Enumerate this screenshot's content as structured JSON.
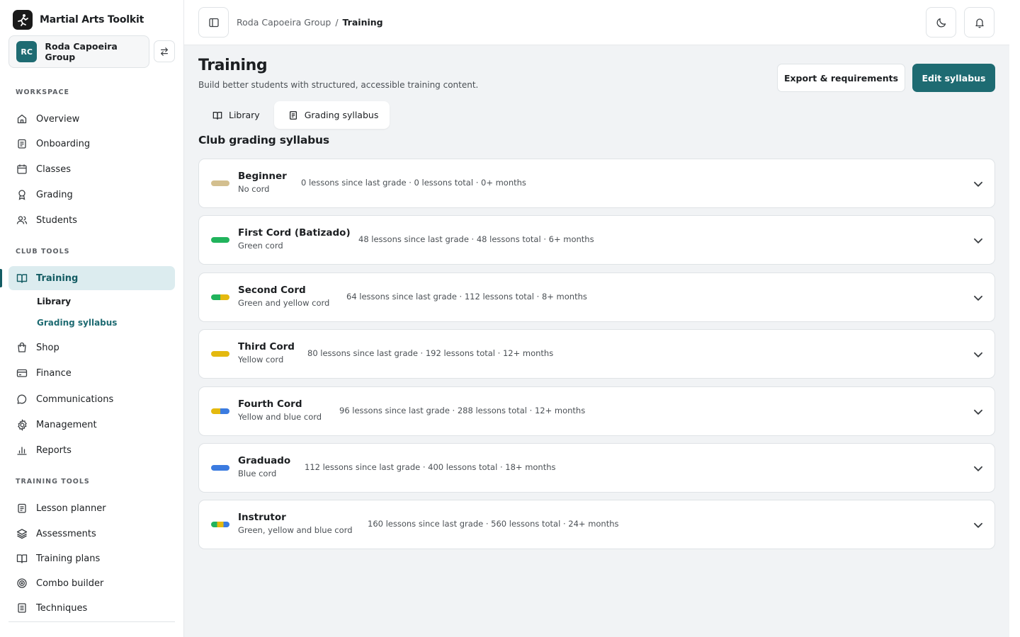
{
  "app": {
    "name": "Martial Arts Toolkit"
  },
  "org": {
    "initials": "RC",
    "name": "Roda Capoeira Group"
  },
  "sidebar": {
    "workspace_label": "WORKSPACE",
    "workspace": [
      {
        "label": "Overview",
        "icon": "home-icon"
      },
      {
        "label": "Onboarding",
        "icon": "clipboard-icon"
      },
      {
        "label": "Classes",
        "icon": "calendar-icon"
      },
      {
        "label": "Grading",
        "icon": "award-icon"
      },
      {
        "label": "Students",
        "icon": "users-icon"
      }
    ],
    "club_label": "CLUB TOOLS",
    "training": {
      "label": "Training",
      "icon": "book-open-icon"
    },
    "training_sub": [
      {
        "label": "Library"
      },
      {
        "label": "Grading syllabus"
      }
    ],
    "club": [
      {
        "label": "Shop",
        "icon": "shopping-bag-icon"
      },
      {
        "label": "Finance",
        "icon": "credit-card-icon"
      },
      {
        "label": "Communications",
        "icon": "message-icon"
      },
      {
        "label": "Management",
        "icon": "gear-icon"
      },
      {
        "label": "Reports",
        "icon": "bar-chart-icon"
      }
    ],
    "tools_label": "TRAINING TOOLS",
    "tools": [
      {
        "label": "Lesson planner",
        "icon": "clipboard-icon"
      },
      {
        "label": "Assessments",
        "icon": "layers-icon"
      },
      {
        "label": "Training plans",
        "icon": "book-open-icon"
      },
      {
        "label": "Combo builder",
        "icon": "target-icon"
      },
      {
        "label": "Techniques",
        "icon": "document-icon"
      }
    ]
  },
  "header": {
    "breadcrumb": [
      "Roda Capoeira Group",
      "/",
      "Training"
    ]
  },
  "main": {
    "title": "Training",
    "subtitle": "Build better students with structured, accessible training content.",
    "export_label": "Export & requirements",
    "edit_label": "Edit syllabus",
    "tabs": [
      {
        "label": "Library",
        "icon": "book-open-icon"
      },
      {
        "label": "Grading syllabus",
        "icon": "document-icon"
      }
    ],
    "section_title": "Club grading syllabus",
    "grades": [
      {
        "name": "Beginner",
        "cord": "No cord",
        "meta": "0 lessons since last grade · 0 lessons total · 0+ months",
        "colors": [
          "#d3bf8f"
        ]
      },
      {
        "name": "First Cord (Batizado)",
        "cord": "Green cord",
        "meta": "48 lessons since last grade · 48 lessons total · 6+ months",
        "colors": [
          "#21b35c"
        ]
      },
      {
        "name": "Second Cord",
        "cord": "Green and yellow cord",
        "meta": "64 lessons since last grade · 112 lessons total · 8+ months",
        "colors": [
          "#21b35c",
          "#e4b90f"
        ]
      },
      {
        "name": "Third Cord",
        "cord": "Yellow cord",
        "meta": "80 lessons since last grade · 192 lessons total · 12+ months",
        "colors": [
          "#e4b90f"
        ]
      },
      {
        "name": "Fourth Cord",
        "cord": "Yellow and blue cord",
        "meta": "96 lessons since last grade · 288 lessons total · 12+ months",
        "colors": [
          "#e4b90f",
          "#3b7be0"
        ]
      },
      {
        "name": "Graduado",
        "cord": "Blue cord",
        "meta": "112 lessons since last grade · 400 lessons total · 18+ months",
        "colors": [
          "#3b7be0"
        ]
      },
      {
        "name": "Instrutor",
        "cord": "Green, yellow and blue cord",
        "meta": "160 lessons since last grade · 560 lessons total · 24+ months",
        "colors": [
          "#21b35c",
          "#e4b90f",
          "#3b7be0"
        ]
      }
    ]
  }
}
